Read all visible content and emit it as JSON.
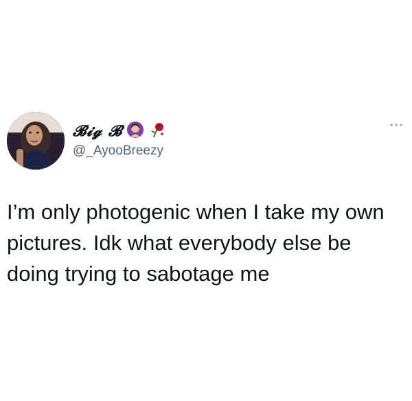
{
  "tweet": {
    "display_name": "𝓑𝓲𝓰 𝓑",
    "handle": "@_AyooBreezy",
    "text": "I’m only photogenic when I take my own pictures. Idk what everybody else be doing trying to sabotage me",
    "name_emojis": [
      "woman-emoji-icon",
      "wilted-rose-icon"
    ]
  },
  "colors": {
    "text": "#0f1419",
    "handle": "#536471",
    "more_dots": "#b7bdc2"
  }
}
